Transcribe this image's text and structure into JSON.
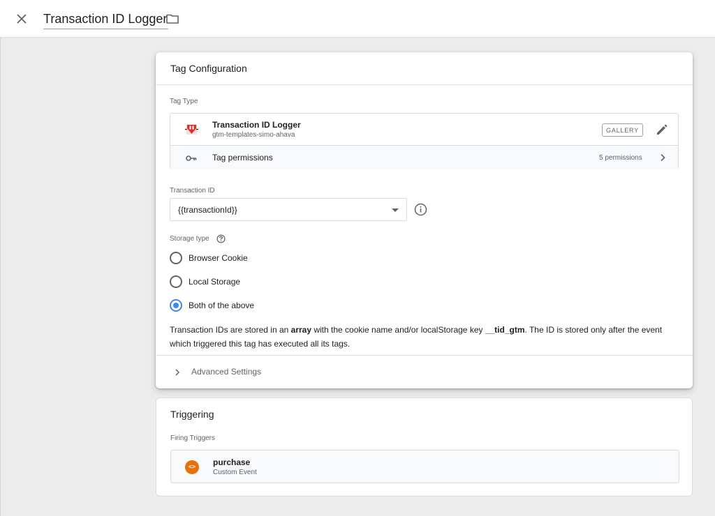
{
  "header": {
    "title": "Transaction ID Logger"
  },
  "tag_config": {
    "heading": "Tag Configuration",
    "tag_type_label": "Tag Type",
    "tag_type": {
      "name": "Transaction ID Logger",
      "publisher": "gtm-templates-simo-ahava",
      "gallery_label": "GALLERY",
      "permissions_label": "Tag permissions",
      "permissions_count": "5 permissions"
    },
    "transaction_id": {
      "label": "Transaction ID",
      "value": "{{transactionId}}"
    },
    "storage": {
      "label": "Storage type",
      "options": [
        {
          "label": "Browser Cookie",
          "selected": false
        },
        {
          "label": "Local Storage",
          "selected": false
        },
        {
          "label": "Both of the above",
          "selected": true
        }
      ]
    },
    "description": {
      "p1": "Transaction IDs are stored in an ",
      "b1": "array",
      "p2": " with the cookie name and/or localStorage key ",
      "b2": "__tid_gtm",
      "p3": ". The ID is stored only after the event which triggered this tag has executed all its tags."
    },
    "advanced_label": "Advanced Settings"
  },
  "triggering": {
    "heading": "Triggering",
    "firing_label": "Firing Triggers",
    "trigger": {
      "name": "purchase",
      "type": "Custom Event",
      "icon_text": "<>"
    }
  },
  "colors": {
    "accent": "#4285f4",
    "trigger_icon": "#e8710a",
    "logo_red": "#d93025"
  },
  "icons": [
    "close-icon",
    "folder-icon",
    "key-icon",
    "pencil-icon",
    "chevron-right-icon",
    "info-icon",
    "help-icon",
    "code-icon"
  ]
}
